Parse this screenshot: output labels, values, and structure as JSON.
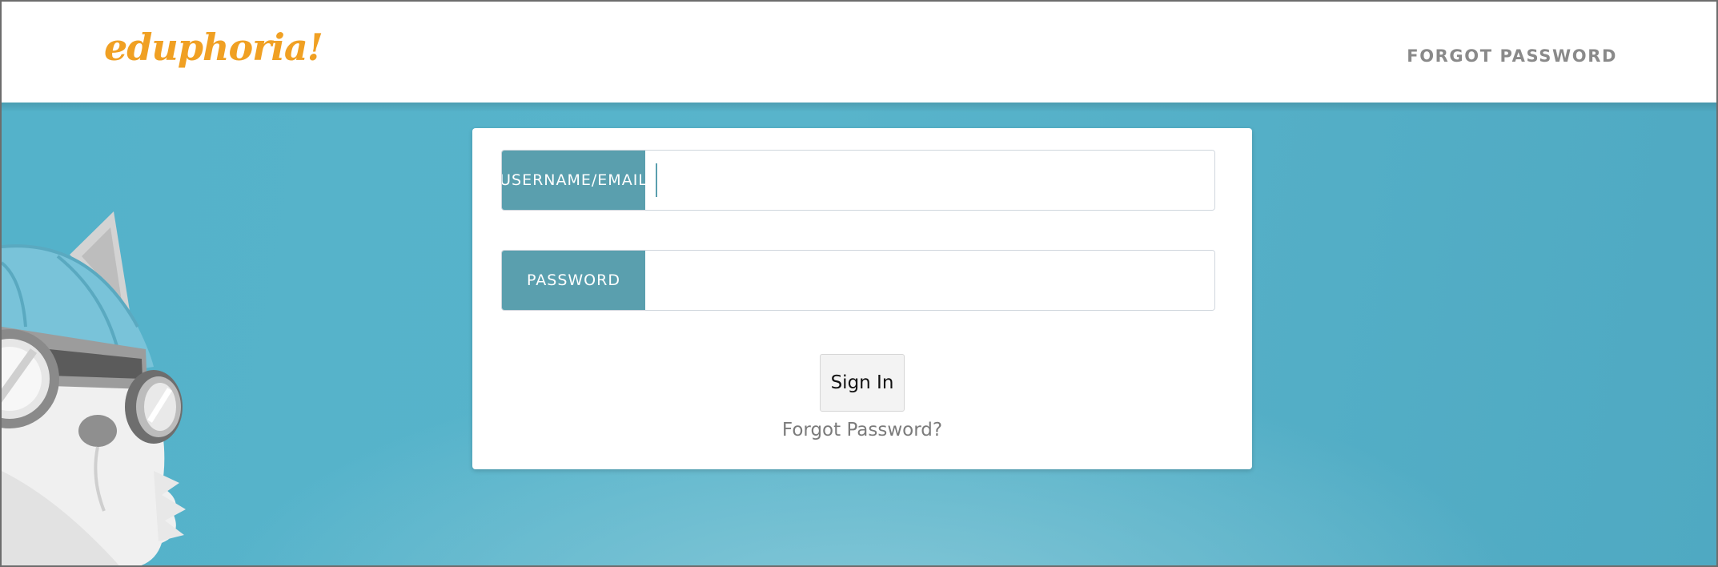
{
  "header": {
    "logo_text": "eduphoria!",
    "forgot_password_link": "FORGOT PASSWORD"
  },
  "login": {
    "username_label": "USERNAME/EMAIL",
    "username_value": "",
    "password_label": "PASSWORD",
    "password_value": "",
    "sign_in_label": "Sign In",
    "forgot_password_link": "Forgot Password?"
  },
  "colors": {
    "logo": "#f0a023",
    "background": "#54b2ca",
    "field_label_bg": "#5a9fae",
    "link_gray": "#8a8a8a"
  },
  "icons": {
    "mascot": "fox-mascot-with-goggles"
  }
}
